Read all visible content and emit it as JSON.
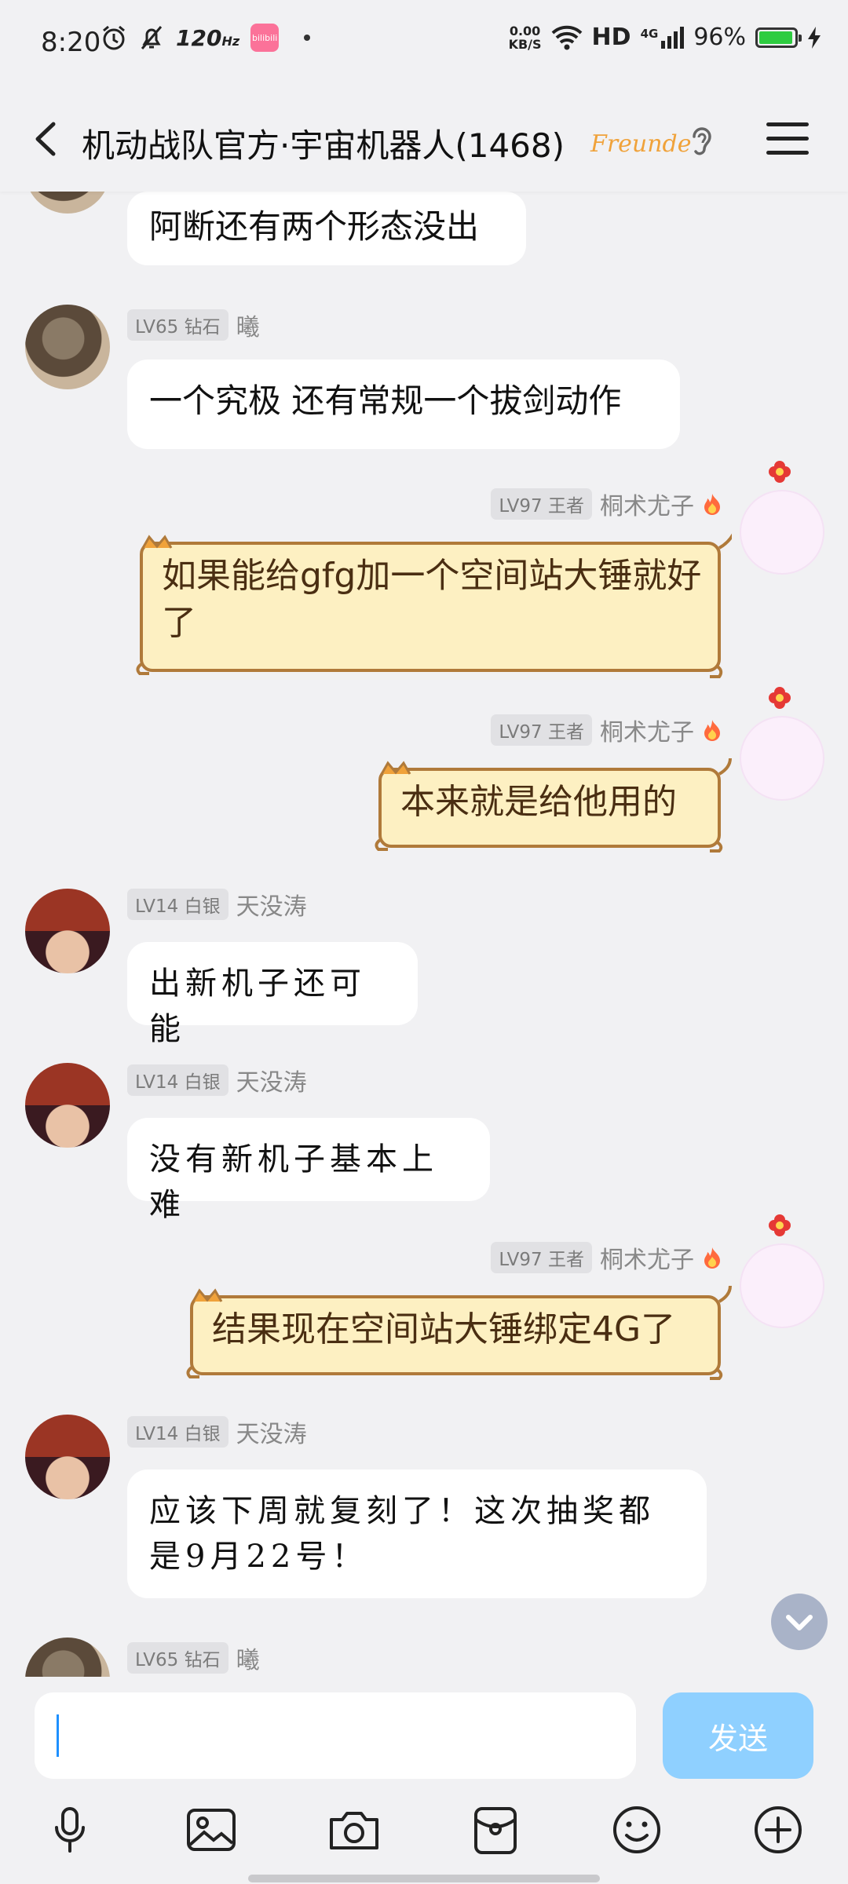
{
  "status_bar": {
    "time": "8:20",
    "refresh_rate": "120",
    "refresh_unit": "Hz",
    "bili_label": "bilibili",
    "net_speed_value": "0.00",
    "net_speed_unit": "KB/S",
    "hd": "HD",
    "network": "4G",
    "battery_pct": "96%",
    "battery_level": 0.96,
    "icons": [
      "alarm-icon",
      "bell-off-icon",
      "bilibili-app-icon",
      "wifi-icon",
      "signal-icon",
      "battery-icon",
      "charging-icon"
    ]
  },
  "header": {
    "title": "机动战队官方·宇宙机器人(1468)",
    "badge": "Freunde",
    "icons": [
      "back-icon",
      "ear-icon",
      "menu-icon"
    ]
  },
  "messages": [
    {
      "sender": "",
      "level": "",
      "text": "阿断还有两个形态没出"
    },
    {
      "sender": "曦",
      "level": "LV65 钻石",
      "text": "一个究极 还有常规一个拔剑动作"
    },
    {
      "sender": "桐术尤子",
      "level": "LV97 王者",
      "text": "如果能给gfg加一个空间站大锤就好了"
    },
    {
      "sender": "桐术尤子",
      "level": "LV97 王者",
      "text": "本来就是给他用的"
    },
    {
      "sender": "天没涛",
      "level": "LV14 白银",
      "text": "出新机子还可能"
    },
    {
      "sender": "天没涛",
      "level": "LV14 白银",
      "text": "没有新机子基本上难"
    },
    {
      "sender": "桐术尤子",
      "level": "LV97 王者",
      "text": "结果现在空间站大锤绑定4G了"
    },
    {
      "sender": "天没涛",
      "level": "LV14 白银",
      "text": "应该下周就复刻了！这次抽奖都是9月22号！"
    },
    {
      "sender": "曦",
      "level": "LV65 钻石",
      "text": ""
    }
  ],
  "input": {
    "placeholder": "",
    "send_label": "发送"
  },
  "toolbar_icons": [
    "microphone-icon",
    "image-icon",
    "camera-icon",
    "red-packet-icon",
    "emoji-icon",
    "plus-icon"
  ],
  "colors": {
    "background": "#f1f1f3",
    "send_button": "#8fd0ff",
    "cat_bubble": "#fdf0c2",
    "cat_bubble_border": "#b07a3a"
  }
}
